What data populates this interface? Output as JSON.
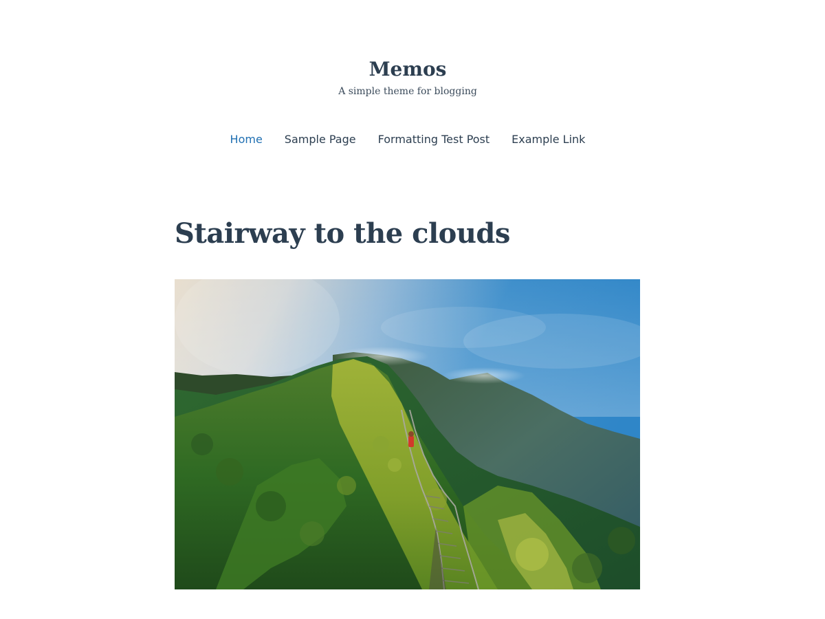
{
  "site": {
    "title": "Memos",
    "tagline": "A simple theme for blogging"
  },
  "nav": {
    "items": [
      {
        "label": "Home",
        "active": true
      },
      {
        "label": "Sample Page",
        "active": false
      },
      {
        "label": "Formatting Test Post",
        "active": false
      },
      {
        "label": "Example Link",
        "active": false
      }
    ]
  },
  "post": {
    "title": "Stairway to the clouds"
  },
  "colors": {
    "text": "#2c3e50",
    "accent_link": "#1f6fb2",
    "background": "#ffffff"
  }
}
